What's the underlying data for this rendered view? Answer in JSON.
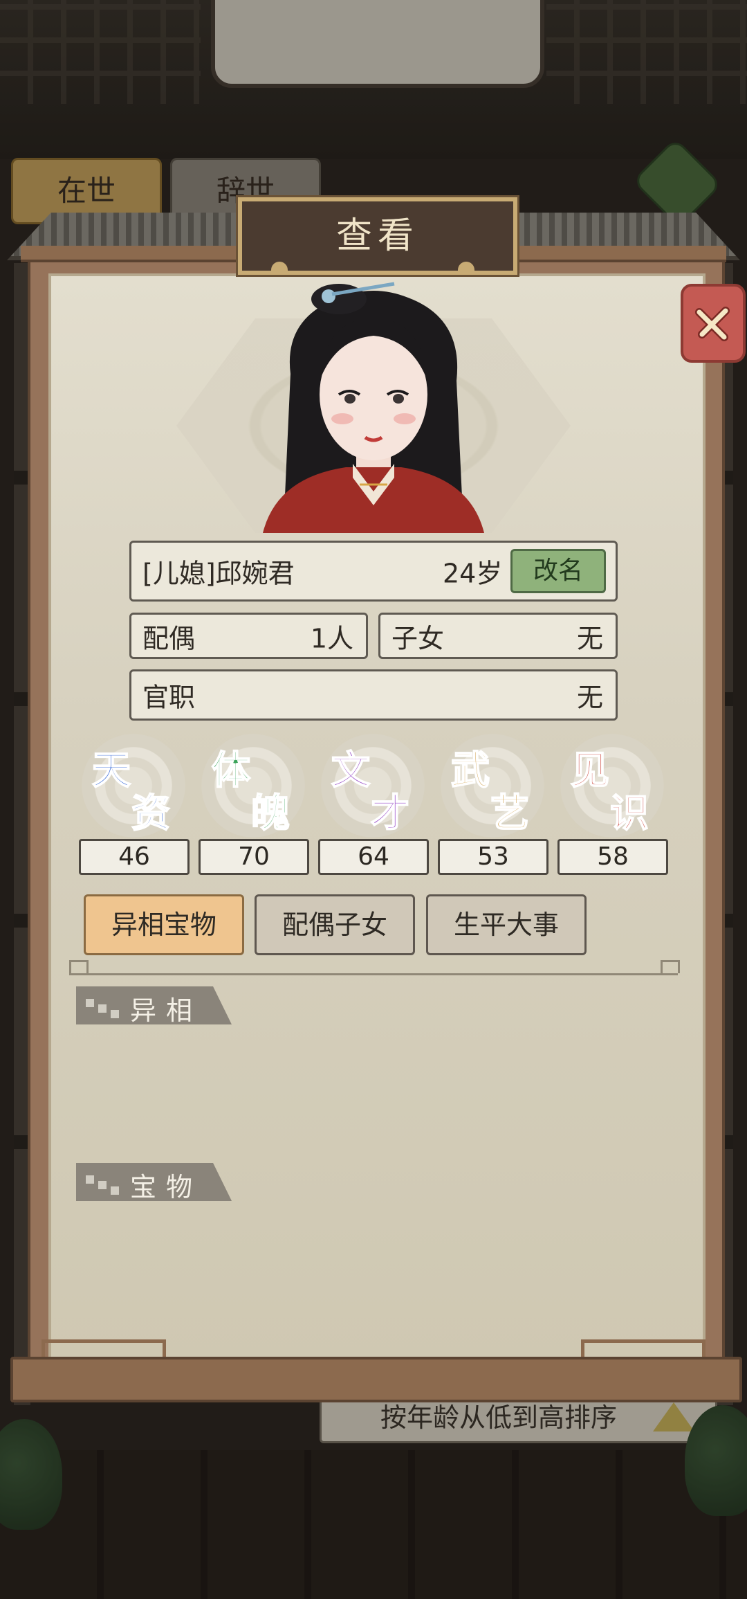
{
  "background": {
    "tabs": [
      "在世",
      "辞世"
    ],
    "sort_label": "按年龄从低到高排序"
  },
  "dialog": {
    "title": "查看",
    "close_icon": "close-x-icon",
    "character": {
      "name": "[儿媳]邱婉君",
      "age": "24岁",
      "rename_label": "改名"
    },
    "spouse": {
      "label": "配偶",
      "value": "1人"
    },
    "children": {
      "label": "子女",
      "value": "无"
    },
    "office": {
      "label": "官职",
      "value": "无"
    },
    "stats": [
      {
        "chars": [
          "天",
          "资"
        ],
        "value": "46",
        "color": "#3f6fd8"
      },
      {
        "chars": [
          "体",
          "魄"
        ],
        "value": "70",
        "color": "#3aa35a"
      },
      {
        "chars": [
          "文",
          "才"
        ],
        "value": "64",
        "color": "#9b4fc9"
      },
      {
        "chars": [
          "武",
          "艺"
        ],
        "value": "53",
        "color": "#c9902d"
      },
      {
        "chars": [
          "见",
          "识"
        ],
        "value": "58",
        "color": "#d0534a"
      }
    ],
    "tabs": [
      {
        "label": "异相宝物",
        "active": true
      },
      {
        "label": "配偶子女",
        "active": false
      },
      {
        "label": "生平大事",
        "active": false
      }
    ],
    "sections": {
      "traits": "异相",
      "treasures": "宝物"
    }
  }
}
